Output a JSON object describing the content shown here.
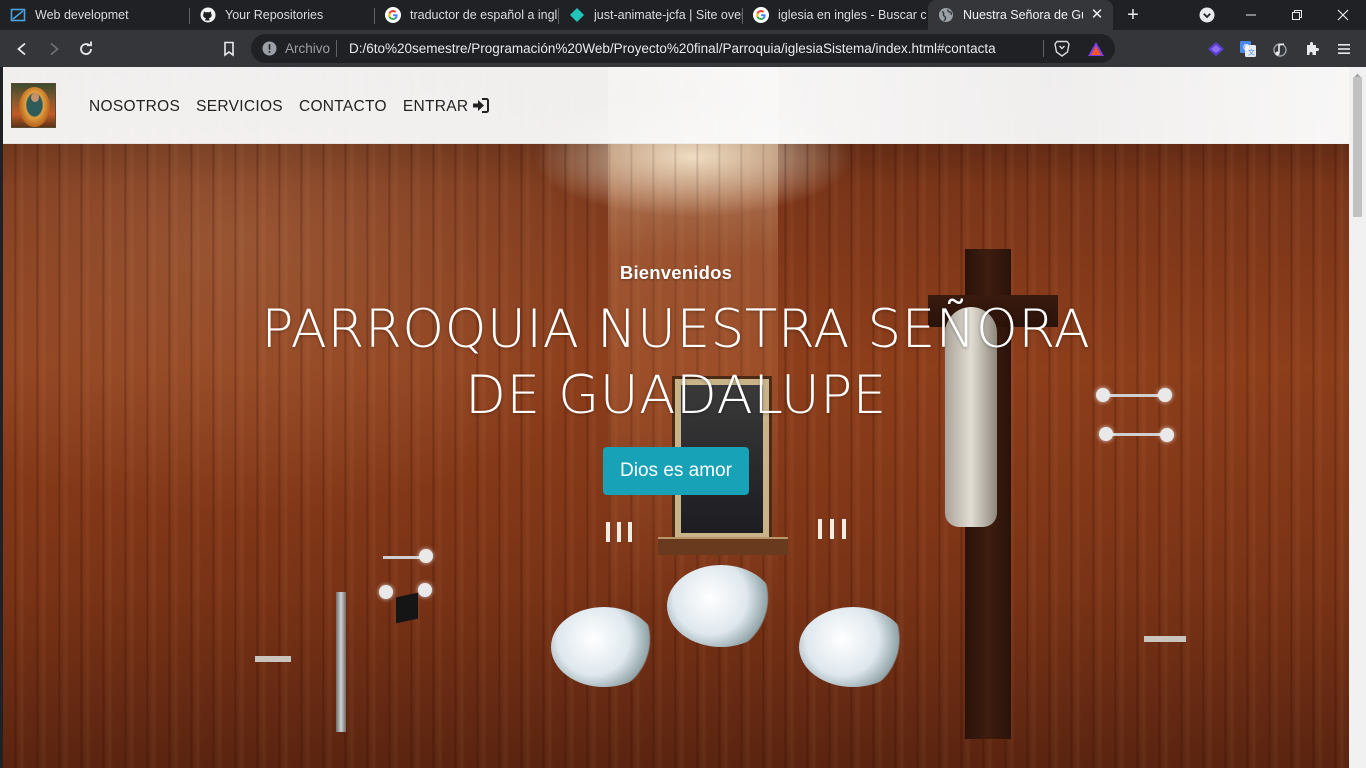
{
  "browser": {
    "tabs": [
      {
        "title": "Web developmet",
        "icon": "zeplin-icon",
        "active": false
      },
      {
        "title": "Your Repositories",
        "icon": "github-icon",
        "active": false
      },
      {
        "title": "traductor de español a ingle",
        "icon": "google-icon",
        "active": false
      },
      {
        "title": "just-animate-jcfa | Site overv",
        "icon": "netlify-icon",
        "active": false
      },
      {
        "title": "iglesia en ingles - Buscar co",
        "icon": "google-icon",
        "active": false
      },
      {
        "title": "Nuestra Señora de Gua",
        "icon": "globe-icon",
        "active": true
      }
    ],
    "address": {
      "scheme_label": "Archivo",
      "url": "D:/6to%20semestre/Programación%20Web/Proyecto%20final/Parroquia/iglesiaSistema/index.html#contacta"
    }
  },
  "page": {
    "nav": {
      "items": [
        "NOSOTROS",
        "SERVICIOS",
        "CONTACTO",
        "ENTRAR"
      ]
    },
    "hero": {
      "subtitle": "Bienvenidos",
      "title": "PARROQUIA NUESTRA SEÑORA DE GUADALUPE",
      "button_label": "Dios es amor"
    }
  },
  "colors": {
    "button_accent": "#17a2b8",
    "browser_frame": "#202124",
    "toolbar": "#35363a"
  }
}
